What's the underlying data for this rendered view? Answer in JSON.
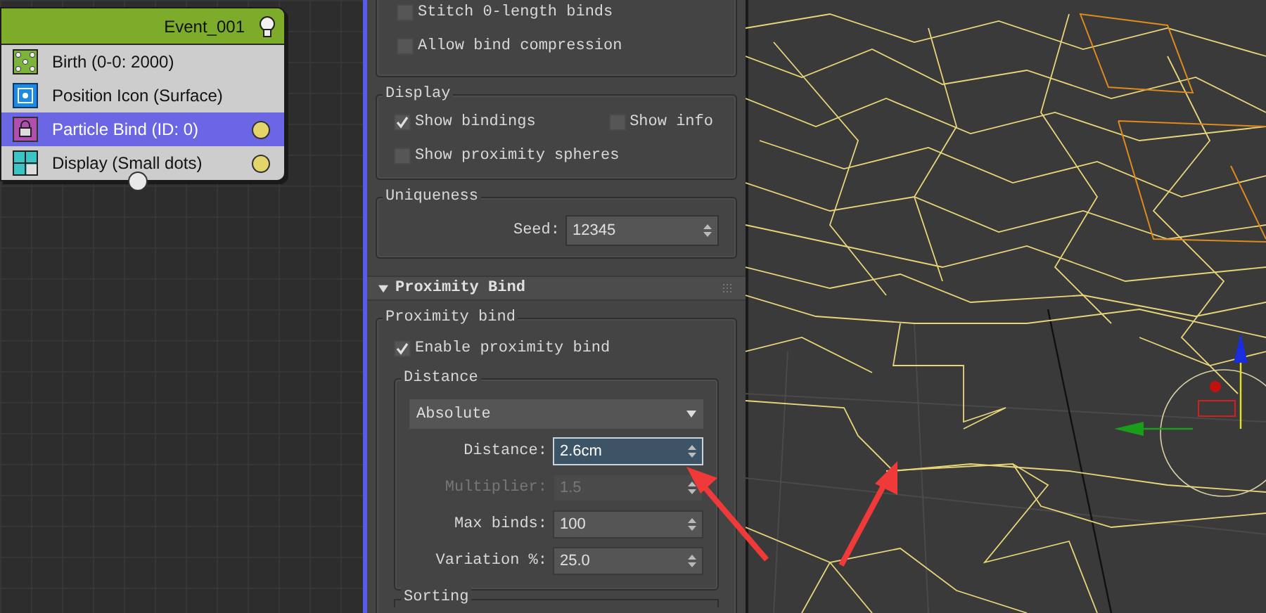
{
  "node_editor": {
    "event": {
      "title": "Event_001",
      "operators": [
        {
          "label": "Birth (0-0: 2000)",
          "kind": "birth",
          "selected": false,
          "has_output": false
        },
        {
          "label": "Position Icon (Surface)",
          "kind": "position",
          "selected": false,
          "has_output": false
        },
        {
          "label": "Particle Bind (ID: 0)",
          "kind": "bind",
          "selected": true,
          "has_output": true
        },
        {
          "label": "Display (Small dots)",
          "kind": "display",
          "selected": false,
          "has_output": true
        }
      ]
    }
  },
  "panel": {
    "top_group": {
      "checkboxes": [
        {
          "label": "Stitch 0-length binds",
          "checked": false
        },
        {
          "label": "Allow bind compression",
          "checked": false
        }
      ]
    },
    "display": {
      "title": "Display",
      "rows": [
        [
          {
            "label": "Show bindings",
            "checked": true
          },
          {
            "label": "Show info",
            "checked": false
          }
        ],
        [
          {
            "label": "Show proximity spheres",
            "checked": false
          }
        ]
      ]
    },
    "uniqueness": {
      "title": "Uniqueness",
      "seed_label": "Seed:",
      "seed_value": "12345"
    },
    "rollout": {
      "title": "Proximity Bind",
      "expanded": true,
      "group_title": "Proximity bind",
      "enable": {
        "label": "Enable proximity bind",
        "checked": true
      },
      "distance_group": {
        "title": "Distance",
        "mode": "Absolute",
        "fields": [
          {
            "label": "Distance:",
            "value": "2.6cm",
            "focused": true,
            "disabled": false
          },
          {
            "label": "Multiplier:",
            "value": "1.5",
            "focused": false,
            "disabled": true
          },
          {
            "label": "Max binds:",
            "value": "100",
            "focused": false,
            "disabled": false
          },
          {
            "label": "Variation %:",
            "value": "25.0",
            "focused": false,
            "disabled": false
          }
        ]
      },
      "next_group_title": "Sorting"
    }
  }
}
